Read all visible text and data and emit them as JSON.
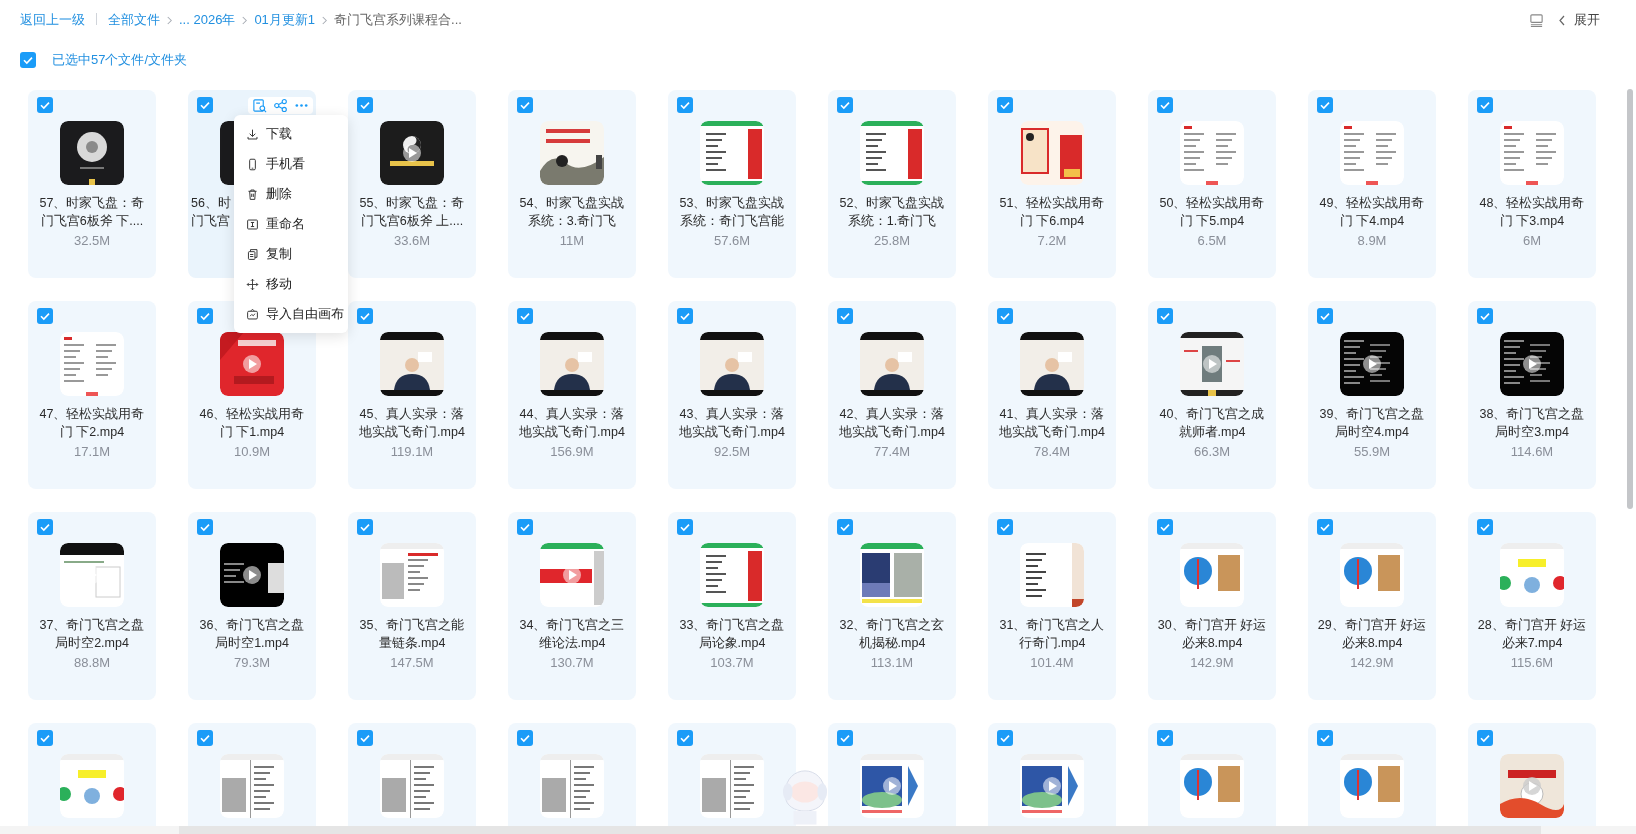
{
  "toolbar": {
    "back": "返回上一级",
    "breadcrumbs": [
      {
        "label": "全部文件",
        "current": false
      },
      {
        "label": "... 2026年",
        "current": false
      },
      {
        "label": "01月更新1",
        "current": false
      },
      {
        "label": "奇门飞宫系列课程合...",
        "current": true
      }
    ],
    "expand": "展开"
  },
  "selection": {
    "checked": true,
    "label": "已选中57个文件/文件夹"
  },
  "files": [
    {
      "title_lines": [
        "57、时家飞盘：奇",
        "门飞宫6板斧 下...."
      ],
      "size": "32.5M",
      "checked": true,
      "hovered": false
    },
    {
      "title_lines": [
        "56、时",
        "门飞宫"
      ],
      "covered": true,
      "checked": true,
      "hovered": true
    },
    {
      "title_lines": [
        "55、时家飞盘：奇",
        "门飞宫6板斧 上...."
      ],
      "size": "33.6M",
      "checked": true,
      "hovered": false
    },
    {
      "title_lines": [
        "54、时家飞盘实战",
        "系统：3.奇门飞"
      ],
      "size": "11M",
      "checked": true,
      "hovered": false
    },
    {
      "title_lines": [
        "53、时家飞盘实战",
        "系统：奇门飞宫能"
      ],
      "size": "57.6M",
      "checked": true,
      "hovered": false
    },
    {
      "title_lines": [
        "52、时家飞盘实战",
        "系统：1.奇门飞"
      ],
      "size": "25.8M",
      "checked": true,
      "hovered": false
    },
    {
      "title_lines": [
        "51、轻松实战用奇",
        "门 下6.mp4"
      ],
      "size": "7.2M",
      "checked": true,
      "hovered": false
    },
    {
      "title_lines": [
        "50、轻松实战用奇",
        "门 下5.mp4"
      ],
      "size": "6.5M",
      "checked": true,
      "hovered": false
    },
    {
      "title_lines": [
        "49、轻松实战用奇",
        "门 下4.mp4"
      ],
      "size": "8.9M",
      "checked": true,
      "hovered": false
    },
    {
      "title_lines": [
        "48、轻松实战用奇",
        "门 下3.mp4"
      ],
      "size": "6M",
      "checked": true,
      "hovered": false
    },
    {
      "title_lines": [
        "47、轻松实战用奇",
        "门 下2.mp4"
      ],
      "size": "17.1M",
      "checked": true,
      "hovered": false
    },
    {
      "title_lines": [
        "46、轻松实战用奇",
        "门 下1.mp4"
      ],
      "size": "10.9M",
      "checked": true,
      "hovered": false
    },
    {
      "title_lines": [
        "45、真人实录：落",
        "地实战飞奇门.mp4"
      ],
      "size": "119.1M",
      "checked": true,
      "hovered": false
    },
    {
      "title_lines": [
        "44、真人实录：落",
        "地实战飞奇门.mp4"
      ],
      "size": "156.9M",
      "checked": true,
      "hovered": false
    },
    {
      "title_lines": [
        "43、真人实录：落",
        "地实战飞奇门.mp4"
      ],
      "size": "92.5M",
      "checked": true,
      "hovered": false
    },
    {
      "title_lines": [
        "42、真人实录：落",
        "地实战飞奇门.mp4"
      ],
      "size": "77.4M",
      "checked": true,
      "hovered": false
    },
    {
      "title_lines": [
        "41、真人实录：落",
        "地实战飞奇门.mp4"
      ],
      "size": "78.4M",
      "checked": true,
      "hovered": false
    },
    {
      "title_lines": [
        "40、奇门飞宫之成",
        "就师者.mp4"
      ],
      "size": "66.3M",
      "checked": true,
      "hovered": false
    },
    {
      "title_lines": [
        "39、奇门飞宫之盘",
        "局时空4.mp4"
      ],
      "size": "55.9M",
      "checked": true,
      "hovered": false
    },
    {
      "title_lines": [
        "38、奇门飞宫之盘",
        "局时空3.mp4"
      ],
      "size": "114.6M",
      "checked": true,
      "hovered": false
    },
    {
      "title_lines": [
        "37、奇门飞宫之盘",
        "局时空2.mp4"
      ],
      "size": "88.8M",
      "checked": true,
      "hovered": false
    },
    {
      "title_lines": [
        "36、奇门飞宫之盘",
        "局时空1.mp4"
      ],
      "size": "79.3M",
      "checked": true,
      "hovered": false
    },
    {
      "title_lines": [
        "35、奇门飞宫之能",
        "量链条.mp4"
      ],
      "size": "147.5M",
      "checked": true,
      "hovered": false
    },
    {
      "title_lines": [
        "34、奇门飞宫之三",
        "维论法.mp4"
      ],
      "size": "130.7M",
      "checked": true,
      "hovered": false
    },
    {
      "title_lines": [
        "33、奇门飞宫之盘",
        "局论象.mp4"
      ],
      "size": "103.7M",
      "checked": true,
      "hovered": false
    },
    {
      "title_lines": [
        "32、奇门飞宫之玄",
        "机揭秘.mp4"
      ],
      "size": "113.1M",
      "checked": true,
      "hovered": false
    },
    {
      "title_lines": [
        "31、奇门飞宫之人",
        "行奇门.mp4"
      ],
      "size": "101.4M",
      "checked": true,
      "hovered": false
    },
    {
      "title_lines": [
        "30、奇门宫开 好运",
        "必来8.mp4"
      ],
      "size": "142.9M",
      "checked": true,
      "hovered": false
    },
    {
      "title_lines": [
        "29、奇门宫开 好运",
        "必来8.mp4"
      ],
      "size": "142.9M",
      "checked": true,
      "hovered": false
    },
    {
      "title_lines": [
        "28、奇门宫开 好运",
        "必来7.mp4"
      ],
      "size": "115.6M",
      "checked": true,
      "hovered": false
    },
    {
      "checked": true,
      "hovered": false
    },
    {
      "checked": true,
      "hovered": false
    },
    {
      "checked": true,
      "hovered": false
    },
    {
      "checked": true,
      "hovered": false
    },
    {
      "checked": true,
      "hovered": false
    },
    {
      "checked": true,
      "hovered": false
    },
    {
      "checked": true,
      "hovered": false
    },
    {
      "checked": true,
      "hovered": false
    },
    {
      "checked": true,
      "hovered": false
    },
    {
      "checked": true,
      "hovered": false
    }
  ],
  "context_menu": {
    "items": [
      {
        "label": "下载",
        "kind": "download"
      },
      {
        "label": "手机看",
        "kind": "phone"
      },
      {
        "label": "删除",
        "kind": "delete"
      },
      {
        "label": "重命名",
        "kind": "rename"
      },
      {
        "label": "复制",
        "kind": "copy"
      },
      {
        "label": "移动",
        "kind": "move"
      },
      {
        "label": "导入自由画布",
        "kind": "canvas"
      }
    ]
  }
}
